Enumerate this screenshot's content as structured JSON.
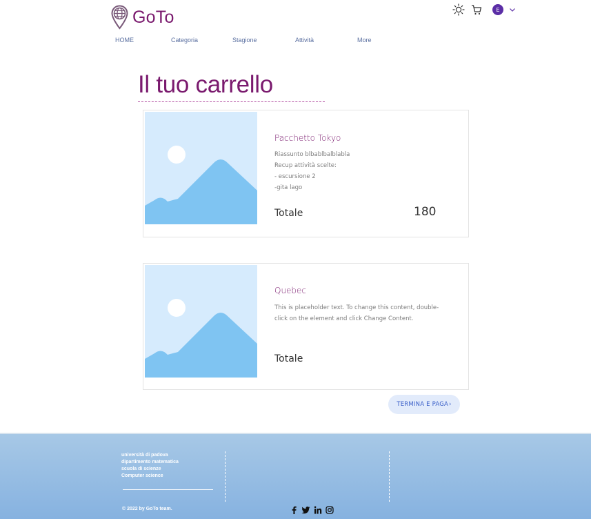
{
  "header": {
    "brand": "GoTo",
    "avatar_letter": "E",
    "nav": [
      "HOME",
      "Categoria",
      "Stagione",
      "Attività",
      "More"
    ]
  },
  "page": {
    "title": "Il tuo carrello"
  },
  "cart": {
    "items": [
      {
        "title": "Pacchetto Tokyo",
        "description": [
          "Riassunto blbablbalblabla",
          "Recup attività scelte:",
          "- escursione 2",
          "-gita lago"
        ],
        "total_label": "Totale",
        "price": "180"
      },
      {
        "title": "Quebec",
        "description": [
          "This is placeholder text. To change this content, double-",
          "click on the element and click Change Content."
        ],
        "total_label": "Totale",
        "price": ""
      }
    ],
    "checkout_button": "TERMINA E PAGA"
  },
  "footer": {
    "lines": [
      "università di padova",
      "dipartimento matematica",
      "scuola di scienze",
      "Computer science"
    ],
    "copyright": "© 2022 by GoTo team.",
    "social": [
      "facebook-icon",
      "twitter-icon",
      "linkedin-icon",
      "instagram-icon"
    ]
  },
  "colors": {
    "brand": "#7a1a6e",
    "nav": "#5a6fa0",
    "button_bg": "#e2ebfb",
    "button_text": "#3a5fc8",
    "footer_bg": "#98bee3",
    "placeholder_sky": "#d6ebfd",
    "placeholder_mountain": "#7fc4f2"
  }
}
